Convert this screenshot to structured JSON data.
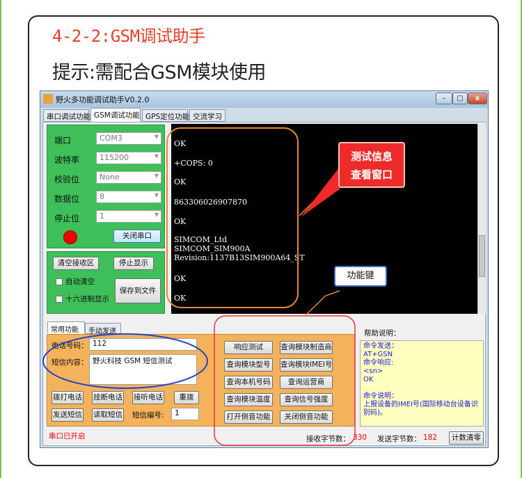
{
  "page": {
    "title": "4-2-2:GSM调试助手",
    "subtitle": "提示:需配合GSM模块使用"
  },
  "window": {
    "title": "野火多功能调试助手V0.2.0",
    "controls": {
      "minimize": "–",
      "maximize": "□",
      "close": "x"
    }
  },
  "tabs": [
    "串口调试功能",
    "GSM调试功能",
    "GPS定位功能",
    "交流学习"
  ],
  "serial": {
    "port_label": "端口",
    "port_value": "COM3",
    "baud_label": "波特率",
    "baud_value": "115200",
    "parity_label": "校验位",
    "parity_value": "None",
    "databits_label": "数据位",
    "databits_value": "8",
    "stopbits_label": "停止位",
    "stopbits_value": "1",
    "close_port_button": "关闭串口",
    "status_color": "#ee0000"
  },
  "receive_panel": {
    "clear_button": "清空接收区",
    "stop_display_button": "停止显示",
    "auto_clear_label": "自动清空",
    "hex_display_label": "十六进制显示",
    "save_file_button": "保存到文件"
  },
  "terminal": {
    "lines": [
      "OK",
      "+COPS: 0",
      "OK",
      "863306026907870",
      "OK",
      "SIMCOM_Ltd",
      "SIMCOM_SIM900A",
      "Revision:1137B13SIM900A64_ST",
      "OK",
      "OK"
    ]
  },
  "lower_tabs": [
    "常用功能",
    "手动发送"
  ],
  "sms": {
    "phone_label": "电话号码：",
    "phone_value": "112",
    "content_label": "短信内容：",
    "content_value": "野火科技 GSM 短信测试",
    "dial_button": "拨打电话",
    "hangup_button": "挂断电话",
    "answer_button": "接听电话",
    "redial_button": "重拨",
    "send_sms_button": "发送短信",
    "read_sms_button": "读取短信",
    "sms_index_label": "短信编号:",
    "sms_index_value": "1"
  },
  "function_buttons": [
    "响应测试",
    "查询模块制造商",
    "查询模块型号",
    "查询模块IMEI号",
    "查询本机号码",
    "查询运营商",
    "查询模块温度",
    "查询信号强度",
    "打开侧音功能",
    "关闭侧音功能"
  ],
  "help": {
    "label": "帮助说明：",
    "lines": [
      "命令发送：",
      "AT+GSN",
      "命令响应:",
      "<sn>",
      "OK",
      "",
      "命令说明：",
      "上报设备的IMEI号(国际移动台设备识别码)。"
    ]
  },
  "status_bar": {
    "port_status": "串口已开启",
    "recv_label": "接收字节数：",
    "recv_value": "330",
    "send_label": "发送字节数：",
    "send_value": "182",
    "clear_count_button": "计数清零"
  },
  "callouts": {
    "terminal_note_line1": "测试信息",
    "terminal_note_line2": "查看窗口",
    "function_keys": "功能键"
  },
  "colors": {
    "title_red": "#e8412a",
    "green_panel": "#3fbf5a",
    "orange_panel": "#f4b25a",
    "annotation_orange": "#e8882e",
    "annotation_red": "#e33",
    "annotation_blue": "#2244cc"
  }
}
